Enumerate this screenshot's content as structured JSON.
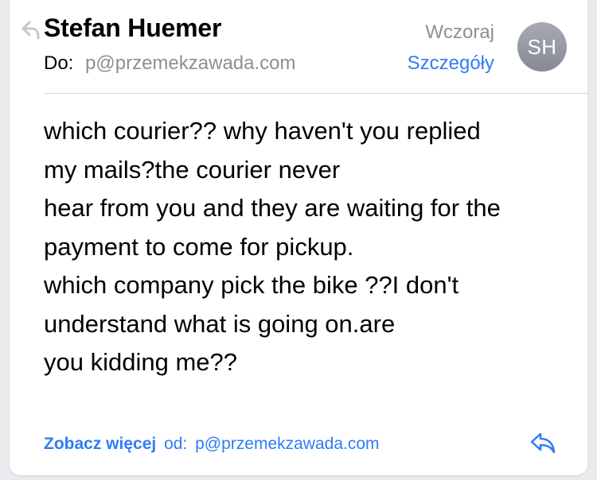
{
  "message": {
    "sender": "Stefan Huemer",
    "date": "Wczoraj",
    "to_label": "Do:",
    "to_address": "p@przemekzawada.com",
    "details_label": "Szczegóły",
    "avatar_initials": "SH",
    "body_lines": [
      "which courier?? why haven't you replied",
      "my mails?the courier never",
      "hear from you and they are waiting for the",
      "payment to come for pickup.",
      "which company pick the bike ??I don't",
      "understand what is going on.are",
      "you kidding me??"
    ]
  },
  "footer": {
    "see_more_label": "Zobacz więcej",
    "from_label": "od:",
    "from_address": "p@przemekzawada.com"
  },
  "icons": {
    "replied_indicator": "reply-arrow-icon",
    "reply_button": "reply-icon"
  },
  "colors": {
    "accent": "#2f7cf6",
    "secondary_text": "#8e8e93",
    "avatar_bg": "#969aa2"
  }
}
